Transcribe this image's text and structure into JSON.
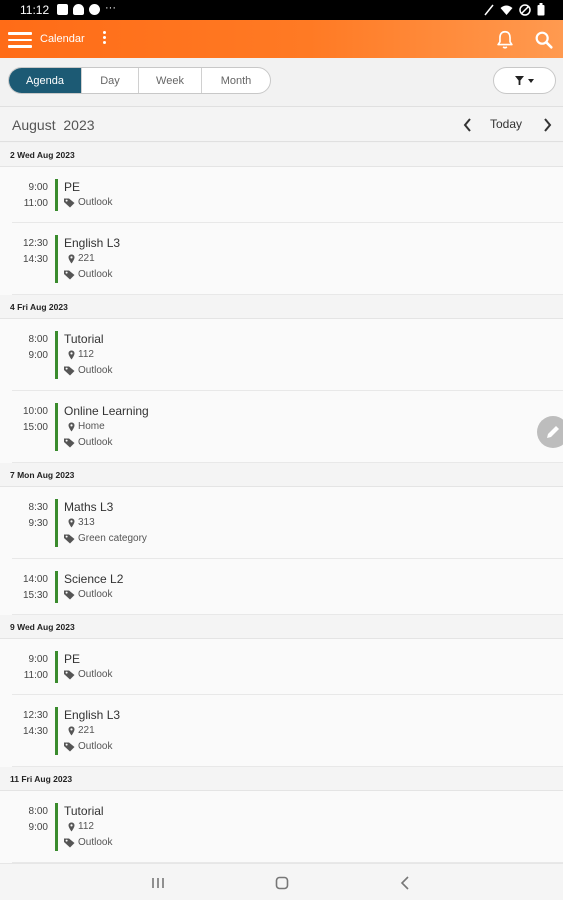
{
  "status": {
    "time": "11:12"
  },
  "appbar": {
    "title": "Calendar"
  },
  "tabs": [
    {
      "label": "Agenda",
      "active": true
    },
    {
      "label": "Day",
      "active": false
    },
    {
      "label": "Week",
      "active": false
    },
    {
      "label": "Month",
      "active": false
    }
  ],
  "month": {
    "label": "August  2023",
    "today_label": "Today"
  },
  "colors": {
    "accent": "#ff6c17",
    "tab_active": "#1c5a74",
    "event_bar": "#3a8b2d"
  },
  "agenda": [
    {
      "date": "2 Wed Aug 2023",
      "events": [
        {
          "start": "9:00",
          "end": "11:00",
          "title": "PE",
          "location": "",
          "category": "Outlook"
        },
        {
          "start": "12:30",
          "end": "14:30",
          "title": "English L3",
          "location": "221",
          "category": "Outlook"
        }
      ]
    },
    {
      "date": "4 Fri Aug 2023",
      "events": [
        {
          "start": "8:00",
          "end": "9:00",
          "title": "Tutorial",
          "location": "112",
          "category": "Outlook"
        },
        {
          "start": "10:00",
          "end": "15:00",
          "title": "Online Learning",
          "location": "Home",
          "category": "Outlook"
        }
      ]
    },
    {
      "date": "7 Mon Aug 2023",
      "events": [
        {
          "start": "8:30",
          "end": "9:30",
          "title": "Maths L3",
          "location": "313",
          "category": "Green category"
        },
        {
          "start": "14:00",
          "end": "15:30",
          "title": "Science L2",
          "location": "",
          "category": "Outlook"
        }
      ]
    },
    {
      "date": "9 Wed Aug 2023",
      "events": [
        {
          "start": "9:00",
          "end": "11:00",
          "title": "PE",
          "location": "",
          "category": "Outlook"
        },
        {
          "start": "12:30",
          "end": "14:30",
          "title": "English L3",
          "location": "221",
          "category": "Outlook"
        }
      ]
    },
    {
      "date": "11 Fri Aug 2023",
      "events": [
        {
          "start": "8:00",
          "end": "9:00",
          "title": "Tutorial",
          "location": "112",
          "category": "Outlook"
        }
      ]
    }
  ]
}
